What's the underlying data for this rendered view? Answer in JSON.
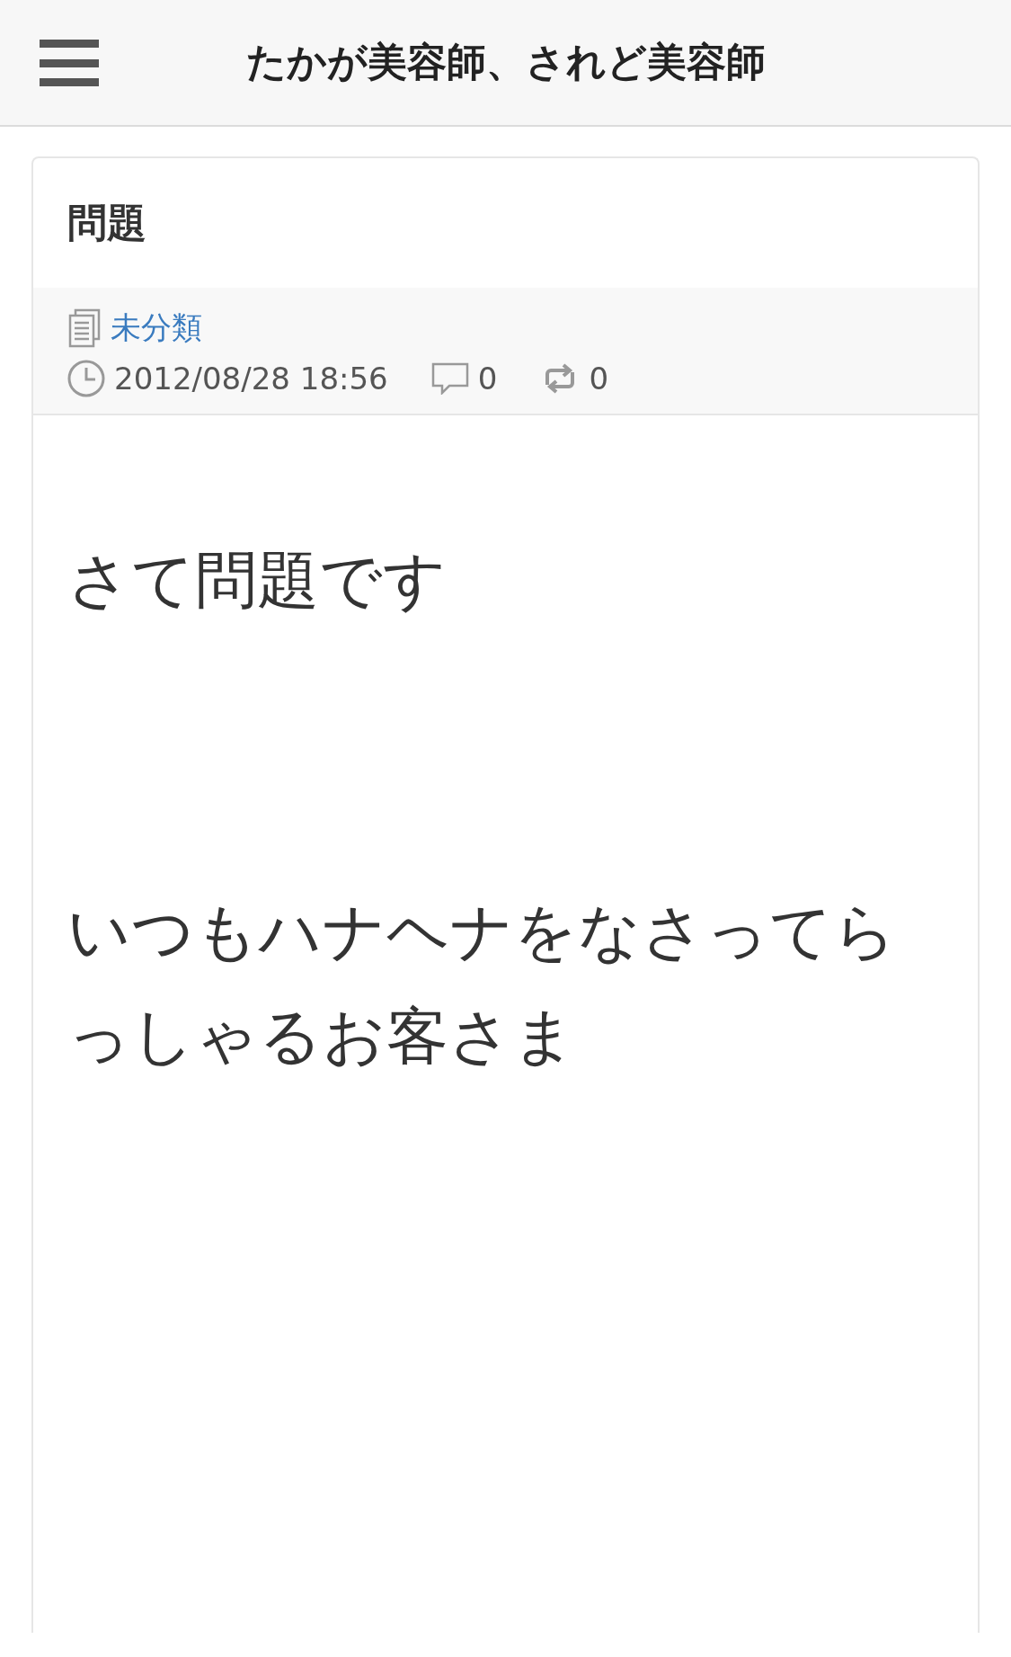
{
  "header": {
    "title": "たかが美容師、されど美容師"
  },
  "post": {
    "title": "問題",
    "category": "未分類",
    "date": "2012/08/28 18:56",
    "comments": "0",
    "reblogs": "0",
    "paragraphs": [
      "さて問題です",
      "いつもハナヘナをなさってらっしゃるお客さま"
    ]
  }
}
